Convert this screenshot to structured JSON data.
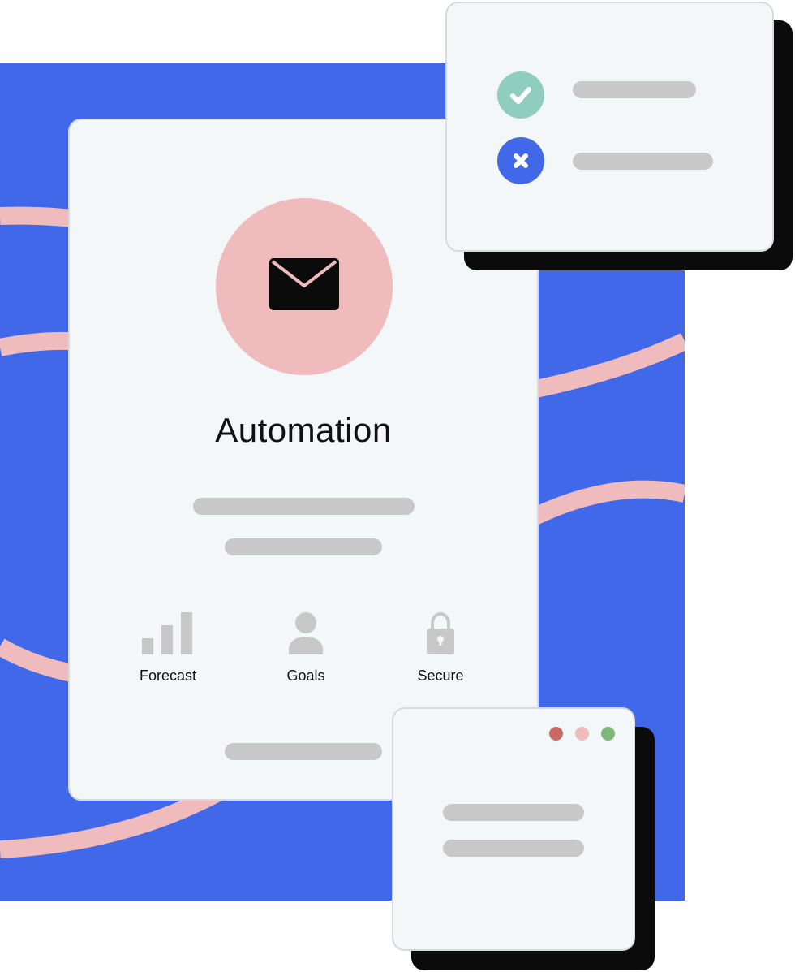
{
  "main_card": {
    "title": "Automation",
    "icon": "envelope-icon",
    "features": [
      {
        "label": "Forecast",
        "icon": "bar-chart-icon"
      },
      {
        "label": "Goals",
        "icon": "user-icon"
      },
      {
        "label": "Secure",
        "icon": "lock-icon"
      }
    ]
  },
  "status_card": {
    "rows": [
      {
        "icon": "check-icon",
        "color": "#8fcdbf"
      },
      {
        "icon": "close-icon",
        "color": "#4168e8"
      }
    ]
  },
  "window_card": {
    "dots": [
      "#c86a66",
      "#f0bbbd",
      "#7fb878"
    ]
  },
  "colors": {
    "backdrop": "#4168e8",
    "wave": "#f0bbbd",
    "card": "#f3f7f7",
    "placeholder": "#c8c8c8",
    "shadow": "#0b0b0b"
  }
}
